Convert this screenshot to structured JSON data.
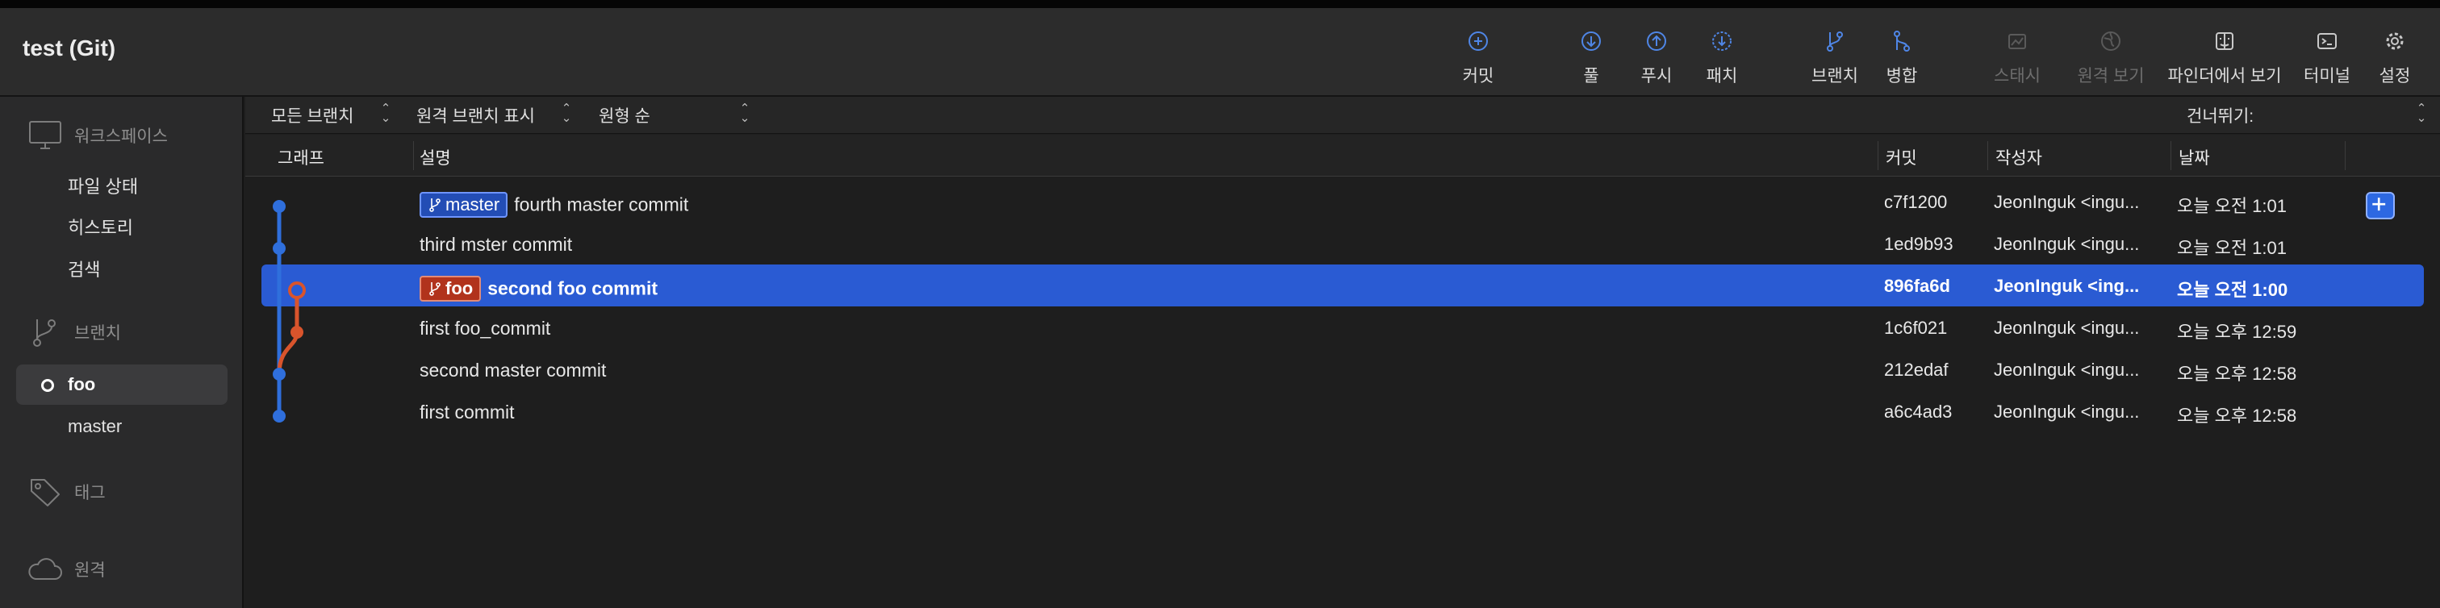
{
  "window": {
    "title": "test (Git)"
  },
  "toolbar": {
    "commit": "커밋",
    "pull": "풀",
    "push": "푸시",
    "fetch": "패치",
    "branch": "브랜치",
    "merge": "병합",
    "stash": "스태시",
    "show_remote": "원격 보기",
    "show_in_finder": "파인더에서 보기",
    "terminal": "터미널",
    "settings": "설정"
  },
  "sidebar": {
    "workspace": "워크스페이스",
    "file_status": "파일 상태",
    "history": "히스토리",
    "search": "검색",
    "branches": "브랜치",
    "branch_items": [
      "foo",
      "master"
    ],
    "tags": "태그",
    "remotes": "원격"
  },
  "filters": {
    "all_branches": "모든 브랜치",
    "show_remote_branches": "원격 브랜치 표시",
    "order": "원형 순",
    "jump_to": "건너뛰기:"
  },
  "columns": {
    "graph": "그래프",
    "description": "설명",
    "commit": "커밋",
    "author": "작성자",
    "date": "날짜"
  },
  "commits": [
    {
      "tag": "master",
      "message": "fourth master commit",
      "hash": "c7f1200",
      "author": "JeonInguk <ingu...",
      "date": "오늘 오전 1:01"
    },
    {
      "tag": "",
      "message": "third mster commit",
      "hash": "1ed9b93",
      "author": "JeonInguk <ingu...",
      "date": "오늘 오전 1:01"
    },
    {
      "tag": "foo",
      "message": "second foo commit",
      "hash": "896fa6d",
      "author": "JeonInguk <ing...",
      "date": "오늘 오전 1:00"
    },
    {
      "tag": "",
      "message": "first foo_commit",
      "hash": "1c6f021",
      "author": "JeonInguk <ingu...",
      "date": "오늘 오후 12:59"
    },
    {
      "tag": "",
      "message": "second master commit",
      "hash": "212edaf",
      "author": "JeonInguk <ingu...",
      "date": "오늘 오후 12:58"
    },
    {
      "tag": "",
      "message": "first commit",
      "hash": "a6c4ad3",
      "author": "JeonInguk <ingu...",
      "date": "오늘 오후 12:58"
    }
  ],
  "colors": {
    "accent_blue": "#2a5bd3",
    "graph_blue": "#2f6fdc",
    "graph_orange": "#d9542c"
  }
}
